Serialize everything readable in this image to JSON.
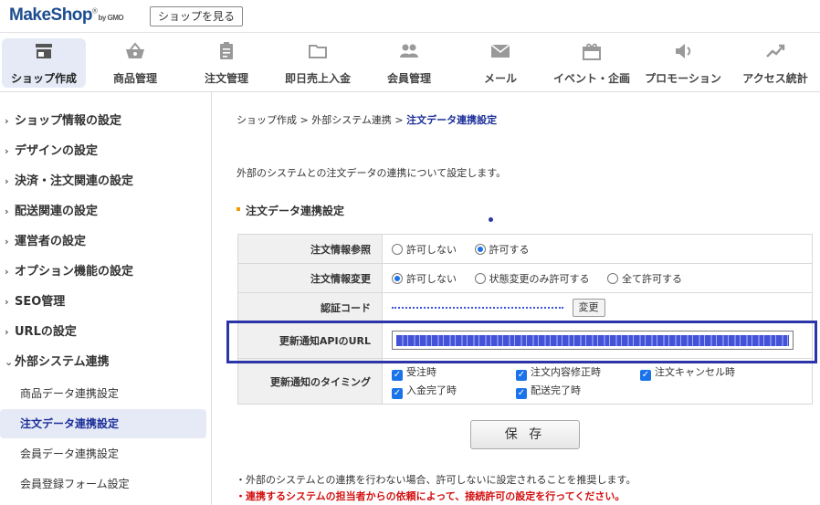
{
  "header": {
    "logo_text": "MakeShop",
    "logo_sub": "by GMO",
    "view_shop_label": "ショップを見る"
  },
  "nav": {
    "items": [
      {
        "label": "ショップ作成",
        "icon": "storefront-icon"
      },
      {
        "label": "商品管理",
        "icon": "basket-icon"
      },
      {
        "label": "注文管理",
        "icon": "clipboard-icon"
      },
      {
        "label": "即日売上入金",
        "icon": "folder-icon"
      },
      {
        "label": "会員管理",
        "icon": "people-icon"
      },
      {
        "label": "メール",
        "icon": "mail-icon"
      },
      {
        "label": "イベント・企画",
        "icon": "gift-icon"
      },
      {
        "label": "プロモーション",
        "icon": "speaker-icon"
      },
      {
        "label": "アクセス統計",
        "icon": "trend-icon"
      }
    ],
    "active_index": 0
  },
  "sidebar": {
    "items": [
      "ショップ情報の設定",
      "デザインの設定",
      "決済・注文関連の設定",
      "配送関連の設定",
      "運営者の設定",
      "オプション機能の設定",
      "SEO管理",
      "URLの設定",
      "外部システム連携"
    ],
    "sub_items": [
      "商品データ連携設定",
      "注文データ連携設定",
      "会員データ連携設定",
      "会員登録フォーム設定"
    ],
    "active_sub_index": 1
  },
  "breadcrumb": {
    "part1": "ショップ作成",
    "part2": "外部システム連携",
    "current": "注文データ連携設定",
    "separator": ">"
  },
  "intro_text": "外部のシステムとの注文データの連携について設定します。",
  "section_title": "注文データ連携設定",
  "form": {
    "order_ref": {
      "label": "注文情報参照",
      "options": [
        "許可しない",
        "許可する"
      ],
      "selected": 1
    },
    "order_change": {
      "label": "注文情報変更",
      "options": [
        "許可しない",
        "状態変更のみ許可する",
        "全て許可する"
      ],
      "selected": 0
    },
    "auth_code": {
      "label": "認証コード",
      "change_label": "変更"
    },
    "api_url": {
      "label": "更新通知APIのURL"
    },
    "timing": {
      "label": "更新通知のタイミング",
      "options": [
        "受注時",
        "注文内容修正時",
        "注文キャンセル時",
        "入金完了時",
        "配送完了時"
      ],
      "checked": [
        true,
        true,
        true,
        true,
        true
      ]
    }
  },
  "save_label": "保 存",
  "notes": {
    "note1": "・外部のシステムとの連携を行わない場合、許可しないに設定されることを推奨します。",
    "note2": "・連携するシステムの担当者からの依頼によって、接続許可の設定を行ってください。"
  },
  "colors": {
    "accent": "#1c2f99",
    "active_bg": "#e6eaf6",
    "highlight_border": "#2b35a8",
    "warning": "#d21010",
    "check": "#1a73e8"
  }
}
